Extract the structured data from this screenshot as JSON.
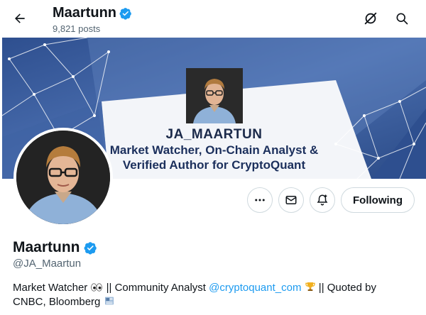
{
  "header": {
    "display_name": "Maartunn",
    "posts_count": "9,821 posts"
  },
  "banner": {
    "handle_text": "JA_MAARTUN",
    "line1": "Market Watcher, On-Chain Analyst &",
    "line2": "Verified Author for CryptoQuant",
    "colors": {
      "dark": "#2e4f8f",
      "light": "#5b7fbd",
      "white_panel": "#f3f5f9"
    }
  },
  "actions": {
    "following_label": "Following"
  },
  "profile": {
    "display_name": "Maartunn",
    "handle": "@JA_Maartun",
    "bio": {
      "part1": "Market Watcher ",
      "part2": " || Community Analyst ",
      "link": "@cryptoquant_com",
      "part3": " || Quoted by",
      "part4": "CNBC, Bloomberg "
    }
  },
  "colors": {
    "verified_blue": "#1d9bf0",
    "text_primary": "#0f1419",
    "text_secondary": "#536471",
    "border": "#cfd9de"
  },
  "icons": {
    "back": "arrow-left-icon",
    "grok": "grok-icon",
    "search": "search-icon",
    "more": "more-dots-icon",
    "message": "envelope-icon",
    "notify": "bell-plus-icon",
    "verified": "verified-badge-icon",
    "eyes": "eyes-emoji",
    "trophy": "trophy-emoji",
    "newspaper": "newspaper-emoji"
  }
}
